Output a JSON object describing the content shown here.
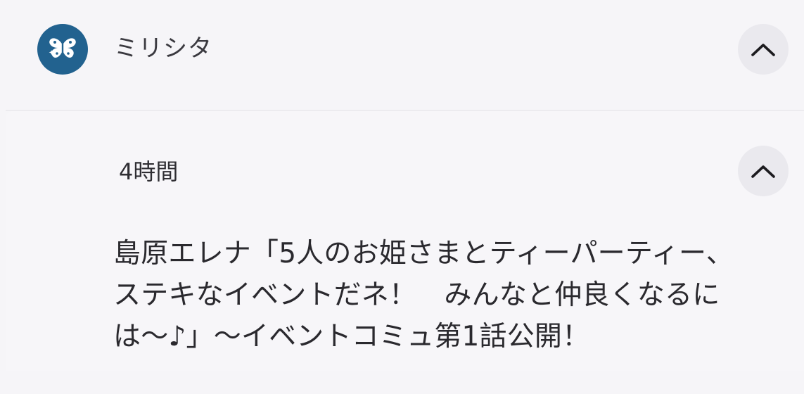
{
  "app": {
    "name": "ミリシタ",
    "icon": "butterfly-icon",
    "icon_color": "#22628f"
  },
  "notification": {
    "timestamp": "4時間",
    "message_lines": [
      "島原エレナ「5人のお姫さまとティーパーティー、",
      "ステキなイベントだネ！　みんなと仲良くなるに",
      "は〜♪」〜イベントコミュ第1話公開！"
    ]
  },
  "controls": {
    "collapse_group_icon": "chevron-up-icon",
    "collapse_notification_icon": "chevron-up-icon"
  }
}
